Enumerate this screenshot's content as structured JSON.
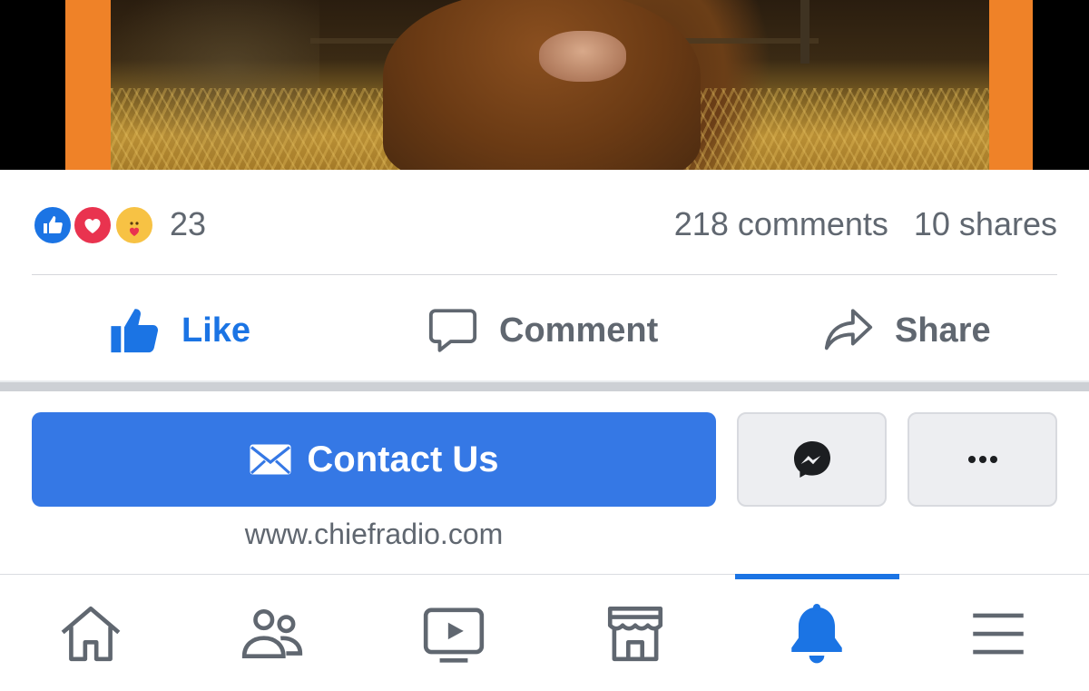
{
  "post": {
    "image_alt": "",
    "reactions": {
      "icons": [
        "like-reaction",
        "love-reaction",
        "care-reaction"
      ],
      "count": "23",
      "comments": "218 comments",
      "shares": "10 shares"
    },
    "actions": {
      "like_label": "Like",
      "comment_label": "Comment",
      "share_label": "Share"
    }
  },
  "page_cta": {
    "contact_label": "Contact Us",
    "website": "www.chiefradio.com",
    "messenger_icon": "messenger-icon",
    "more_icon": "more-dots-icon"
  },
  "tabbar": {
    "tabs": [
      {
        "name": "home",
        "icon": "home-icon",
        "active": false
      },
      {
        "name": "friends",
        "icon": "friends-icon",
        "active": false
      },
      {
        "name": "watch",
        "icon": "watch-icon",
        "active": false
      },
      {
        "name": "marketplace",
        "icon": "marketplace-icon",
        "active": false
      },
      {
        "name": "notifications",
        "icon": "bell-icon",
        "active": true
      },
      {
        "name": "menu",
        "icon": "hamburger-menu-icon",
        "active": false
      }
    ]
  },
  "colors": {
    "brand_blue": "#1b74e4",
    "cta_blue": "#3578e5",
    "secondary_text": "#606770",
    "frame_orange": "#ef8228"
  }
}
